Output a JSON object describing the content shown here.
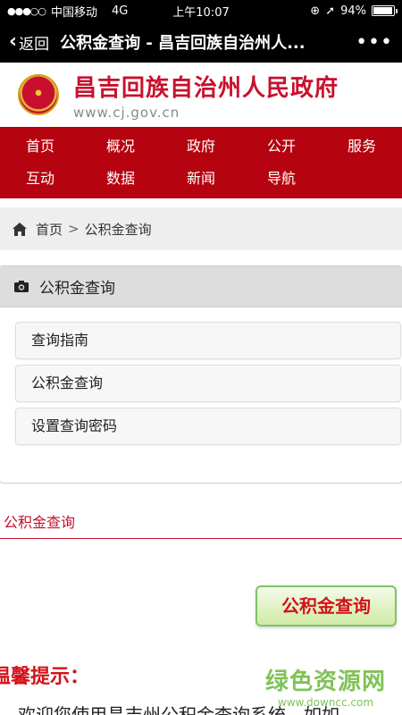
{
  "status": {
    "carrier": "中国移动",
    "network": "4G",
    "time": "上午10:07",
    "battery": "94%",
    "battery_level": 0.94
  },
  "nav": {
    "back_label": "返回",
    "title": "公积金查询 - 昌吉回族自治州人...",
    "more": "•••"
  },
  "banner": {
    "site_name": "昌吉回族自治州人民政府",
    "url": "www.cj.gov.cn"
  },
  "mainnav": {
    "row1": [
      "首页",
      "概况",
      "政府",
      "公开",
      "服务"
    ],
    "row2": [
      "互动",
      "数据",
      "新闻",
      "导航"
    ]
  },
  "breadcrumb": {
    "home": "首页",
    "separator": ">",
    "current": "公积金查询"
  },
  "panel": {
    "title": "公积金查询",
    "items": [
      "查询指南",
      "公积金查询",
      "设置查询密码"
    ]
  },
  "section_title": "公积金查询",
  "query_button": "公积金查询",
  "tip_title": "温馨提示：",
  "tip_text": "欢迎您使用昌吉州公积金查询系统，如如",
  "watermark": {
    "main": "绿色资源网",
    "sub": "www.downcc.com"
  }
}
